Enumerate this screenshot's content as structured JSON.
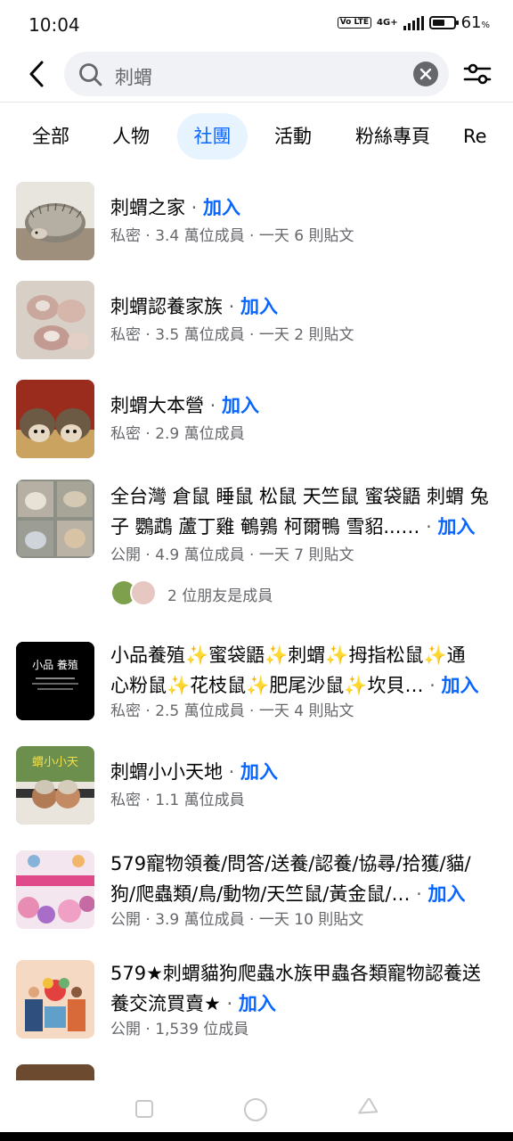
{
  "status_bar": {
    "time": "10:04",
    "volte": "Vo LTE",
    "network": "4G+",
    "battery_level": 0.61,
    "battery_text": "61",
    "battery_unit": "%"
  },
  "search": {
    "query": "刺蝟"
  },
  "tabs": [
    {
      "label": "全部",
      "active": false
    },
    {
      "label": "人物",
      "active": false
    },
    {
      "label": "社團",
      "active": true
    },
    {
      "label": "活動",
      "active": false
    },
    {
      "label": "粉絲專頁",
      "active": false
    },
    {
      "label": "Re",
      "active": false
    }
  ],
  "results": [
    {
      "name": "刺蝟之家",
      "join": "加入",
      "meta": "私密 · 3.4 萬位成員 · 一天 6 則貼文"
    },
    {
      "name": "刺蝟認養家族",
      "join": "加入",
      "meta": "私密 · 3.5 萬位成員 · 一天 2 則貼文"
    },
    {
      "name": "刺蝟大本營",
      "join": "加入",
      "meta": "私密 · 2.9 萬位成員"
    },
    {
      "name_line1": "全台灣 倉鼠 睡鼠 松鼠 天竺鼠 蜜袋鼯 刺蝟 兔",
      "name_line2": "子 鸚鵡 蘆丁雞 鵪鶉 柯爾鴨 雪貂...…",
      "join": "加入",
      "meta": "公開 · 4.9 萬位成員 · 一天 7 則貼文",
      "friends": "2 位朋友是成員"
    },
    {
      "name_line1": "小品養殖✨蜜袋鼯✨刺蝟✨拇指松鼠✨通",
      "name_line2": "心粉鼠✨花枝鼠✨肥尾沙鼠✨坎貝…",
      "join": "加入",
      "meta": "私密 · 2.5 萬位成員 · 一天 4 則貼文",
      "thumb_text": "小品 養殖"
    },
    {
      "name": "刺蝟小小天地",
      "join": "加入",
      "meta": "私密 · 1.1 萬位成員",
      "thumb_text": "蝟小小天"
    },
    {
      "name_line1": "579寵物領養/問答/送養/認養/協尋/拾獲/貓/",
      "name_line2": "狗/爬蟲類/鳥/動物/天竺鼠/黃金鼠/…",
      "join": "加入",
      "meta": "公開 · 3.9 萬位成員 · 一天 10 則貼文"
    },
    {
      "name_line1": "579★刺蝟貓狗爬蟲水族甲蟲各類寵物認養送",
      "name_line2": "養交流買賣★",
      "join": "加入",
      "meta": "公開 · 1,539 位成員"
    }
  ],
  "colors": {
    "accent": "#0866ff",
    "secondary_text": "#65676b",
    "search_bg": "#f0f2f5",
    "active_tab_bg": "#e7f3ff"
  },
  "icons": [
    "back-arrow-icon",
    "search-icon",
    "clear-icon",
    "filter-icon",
    "recent-apps-icon",
    "home-icon",
    "back-icon"
  ]
}
